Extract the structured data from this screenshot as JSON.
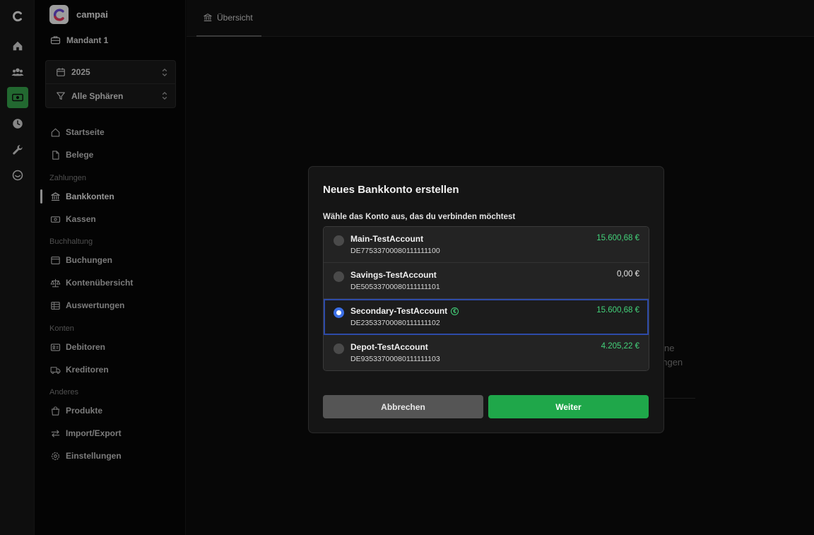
{
  "brand": {
    "name": "campai"
  },
  "mandant": {
    "label": "Mandant 1"
  },
  "filters": {
    "year": "2025",
    "sphere": "Alle Sphären"
  },
  "nav": {
    "startseite": "Startseite",
    "belege": "Belege",
    "section_zahlungen": "Zahlungen",
    "bankkonten": "Bankkonten",
    "kassen": "Kassen",
    "section_buchhaltung": "Buchhaltung",
    "buchungen": "Buchungen",
    "kontenuebersicht": "Kontenübersicht",
    "auswertungen": "Auswertungen",
    "section_konten": "Konten",
    "debitoren": "Debitoren",
    "kreditoren": "Kreditoren",
    "section_anderes": "Anderes",
    "produkte": "Produkte",
    "import_export": "Import/Export",
    "einstellungen": "Einstellungen"
  },
  "main": {
    "tab": "Übersicht",
    "bg_text_1": "ne",
    "bg_text_2": "ungen"
  },
  "modal": {
    "title": "Neues Bankkonto erstellen",
    "subtitle": "Wähle das Konto aus, das du verbinden möchtest",
    "accounts": [
      {
        "name": "Main-TestAccount",
        "iban": "DE77533700080111111100",
        "amount": "15.600,68 €",
        "selected": false
      },
      {
        "name": "Savings-TestAccount",
        "iban": "DE50533700080111111101",
        "amount": "0,00 €",
        "selected": false
      },
      {
        "name": "Secondary-TestAccount",
        "iban": "DE23533700080111111102",
        "amount": "15.600,68 €",
        "selected": true,
        "badge": "€"
      },
      {
        "name": "Depot-TestAccount",
        "iban": "DE93533700080111111103",
        "amount": "4.205,22 €",
        "selected": false
      }
    ],
    "cancel_label": "Abbrechen",
    "next_label": "Weiter"
  },
  "colors": {
    "accent_green": "#1fa74a",
    "amount_green": "#43d27a",
    "selected_blue": "#3b6fe6"
  }
}
